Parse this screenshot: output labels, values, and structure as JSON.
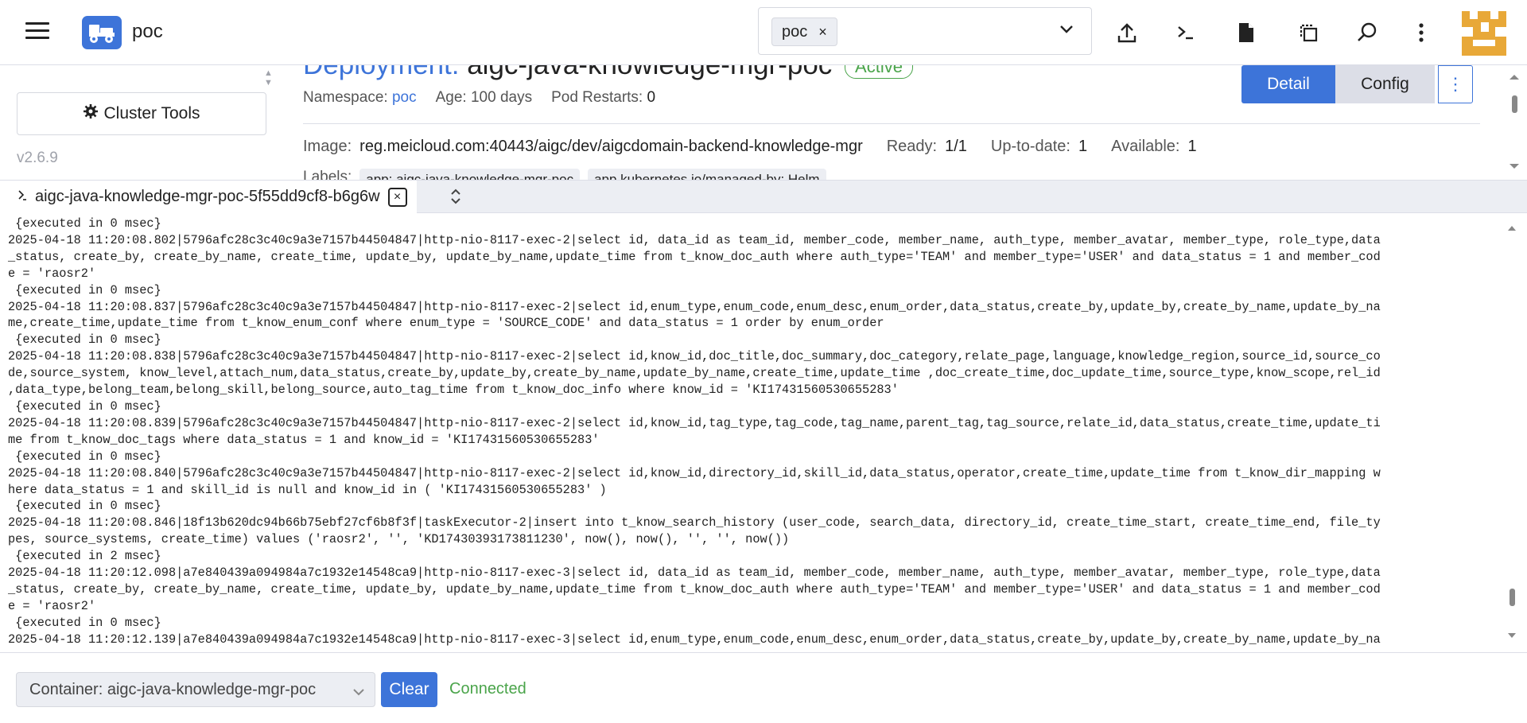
{
  "header": {
    "cluster_name": "poc",
    "namespace_chip": "poc",
    "namespace_chip_remove": "×"
  },
  "sidebar": {
    "cluster_tools_label": "Cluster Tools",
    "version": "v2.6.9"
  },
  "deployment": {
    "kind_label": "Deployment:",
    "name": "aigc-java-knowledge-mgr-poc",
    "state": "Active",
    "namespace_label": "Namespace:",
    "namespace": "poc",
    "age_label": "Age:",
    "age": "100 days",
    "restarts_label": "Pod Restarts:",
    "restarts": "0",
    "image_label": "Image:",
    "image": "reg.meicloud.com:40443/aigc/dev/aigcdomain-backend-knowledge-mgr",
    "ready_label": "Ready:",
    "ready": "1/1",
    "uptodate_label": "Up-to-date:",
    "uptodate": "1",
    "available_label": "Available:",
    "available": "1",
    "labels_label": "Labels:",
    "label_1": "app: aigc-java-knowledge-mgr-poc",
    "label_2": "app.kubernetes.io/managed-by: Helm",
    "detail_button": "Detail",
    "config_button": "Config",
    "more_button": "⋮"
  },
  "terminal": {
    "tab_title": "aigc-java-knowledge-mgr-poc-5f55dd9cf8-b6g6w",
    "tab_close": "×",
    "log": " {executed in 0 msec}\n2025-04-18 11:20:08.802|5796afc28c3c40c9a3e7157b44504847|http-nio-8117-exec-2|select id, data_id as team_id, member_code, member_name, auth_type, member_avatar, member_type, role_type,data\n_status, create_by, create_by_name, create_time, update_by, update_by_name,update_time from t_know_doc_auth where auth_type='TEAM' and member_type='USER' and data_status = 1 and member_cod\ne = 'raosr2'\n {executed in 0 msec}\n2025-04-18 11:20:08.837|5796afc28c3c40c9a3e7157b44504847|http-nio-8117-exec-2|select id,enum_type,enum_code,enum_desc,enum_order,data_status,create_by,update_by,create_by_name,update_by_na\nme,create_time,update_time from t_know_enum_conf where enum_type = 'SOURCE_CODE' and data_status = 1 order by enum_order\n {executed in 0 msec}\n2025-04-18 11:20:08.838|5796afc28c3c40c9a3e7157b44504847|http-nio-8117-exec-2|select id,know_id,doc_title,doc_summary,doc_category,relate_page,language,knowledge_region,source_id,source_co\nde,source_system, know_level,attach_num,data_status,create_by,update_by,create_by_name,update_by_name,create_time,update_time ,doc_create_time,doc_update_time,source_type,know_scope,rel_id\n,data_type,belong_team,belong_skill,belong_source,auto_tag_time from t_know_doc_info where know_id = 'KI17431560530655283'\n {executed in 0 msec}\n2025-04-18 11:20:08.839|5796afc28c3c40c9a3e7157b44504847|http-nio-8117-exec-2|select id,know_id,tag_type,tag_code,tag_name,parent_tag,tag_source,relate_id,data_status,create_time,update_ti\nme from t_know_doc_tags where data_status = 1 and know_id = 'KI17431560530655283'\n {executed in 0 msec}\n2025-04-18 11:20:08.840|5796afc28c3c40c9a3e7157b44504847|http-nio-8117-exec-2|select id,know_id,directory_id,skill_id,data_status,operator,create_time,update_time from t_know_dir_mapping w\nhere data_status = 1 and skill_id is null and know_id in ( 'KI17431560530655283' )\n {executed in 0 msec}\n2025-04-18 11:20:08.846|18f13b620dc94b66b75ebf27cf6b8f3f|taskExecutor-2|insert into t_know_search_history (user_code, search_data, directory_id, create_time_start, create_time_end, file_ty\npes, source_systems, create_time) values ('raosr2', '', 'KD17430393173811230', now(), now(), '', '', now())\n {executed in 2 msec}\n2025-04-18 11:20:12.098|a7e840439a094984a7c1932e14548ca9|http-nio-8117-exec-3|select id, data_id as team_id, member_code, member_name, auth_type, member_avatar, member_type, role_type,data\n_status, create_by, create_by_name, create_time, update_by, update_by_name,update_time from t_know_doc_auth where auth_type='TEAM' and member_type='USER' and data_status = 1 and member_cod\ne = 'raosr2'\n {executed in 0 msec}\n2025-04-18 11:20:12.139|a7e840439a094984a7c1932e14548ca9|http-nio-8117-exec-3|select id,enum_type,enum_code,enum_desc,enum_order,data_status,create_by,update_by,create_by_name,update_by_na"
  },
  "footer": {
    "container_select": "Container: aigc-java-knowledge-mgr-poc",
    "clear_button": "Clear",
    "status": "Connected"
  },
  "colors": {
    "accent": "#3d74d9",
    "success": "#4aa44a",
    "avatar": "#e8a838"
  }
}
